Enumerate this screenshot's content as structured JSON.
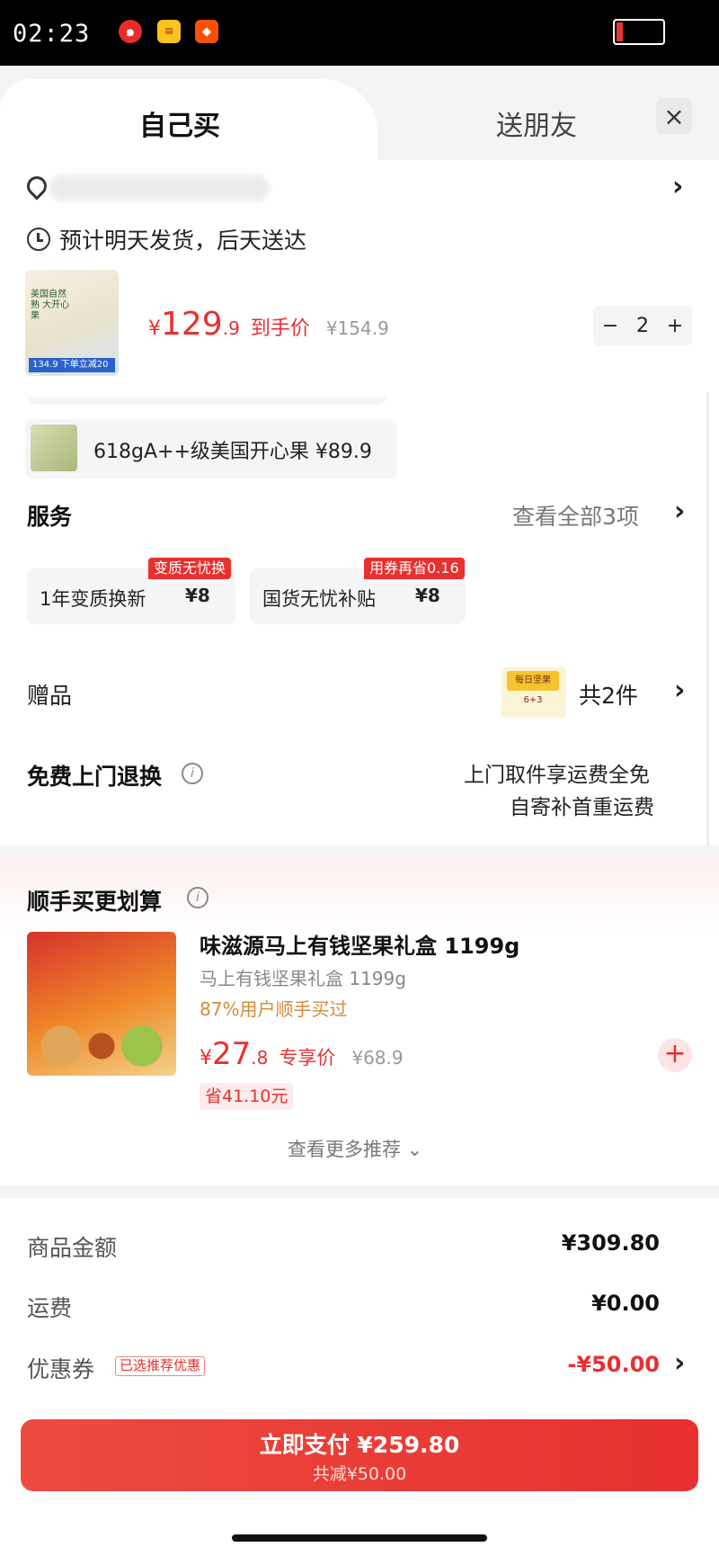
{
  "status_bar": {
    "time": "02:23",
    "apps": [
      "netease-music-icon",
      "tianmao-icon",
      "taobao-icon"
    ]
  },
  "tabs": {
    "self": "自己买",
    "friend": "送朋友"
  },
  "delivery": {
    "text": "预计明天发货，后天送达"
  },
  "product": {
    "price_currency": "¥",
    "price_int": "129",
    "price_dec": ".9",
    "price_tag": "到手价",
    "original_price": "¥154.9",
    "quantity": "2",
    "minus": "−",
    "plus": "+",
    "image_badge": "134.9 下单立减20元",
    "image_text": "美国自然熟 大开心果"
  },
  "bundle": {
    "text": "618gA++级美国开心果  ¥89.9"
  },
  "services": {
    "title": "服务",
    "view_all": "查看全部3项",
    "items": [
      {
        "name": "1年变质换新",
        "price": "¥8",
        "badge": "变质无忧换"
      },
      {
        "name": "国货无忧补贴",
        "price": "¥8",
        "badge": "用券再省0.16"
      }
    ]
  },
  "gift": {
    "label": "赠品",
    "count": "共2件",
    "image_text": "每日坚果 6+3"
  },
  "returns": {
    "title": "免费上门退换",
    "line1": "上门取件享运费全免",
    "line2": "自寄补首重运费"
  },
  "recommend": {
    "title": "顺手买更划算",
    "name": "味滋源马上有钱坚果礼盒 1199g",
    "sub": "马上有钱坚果礼盒 1199g",
    "bought": "87%用户顺手买过",
    "price_currency": "¥",
    "price_int": "27",
    "price_dec": ".8",
    "price_tag": "专享价",
    "original_price": "¥68.9",
    "save": "省41.10元",
    "add": "+",
    "more": "查看更多推荐 ⌄"
  },
  "summary": {
    "goods_label": "商品金额",
    "goods_value": "¥309.80",
    "shipping_label": "运费",
    "shipping_value": "¥0.00",
    "coupon_label": "优惠券",
    "coupon_tag": "已选推荐优惠",
    "coupon_value": "-¥50.00"
  },
  "pay": {
    "main": "立即支付 ¥259.80",
    "sub": "共减¥50.00"
  },
  "colors": {
    "accent": "#e8302f",
    "background": "#ffffff",
    "muted": "#f4f4f4"
  }
}
